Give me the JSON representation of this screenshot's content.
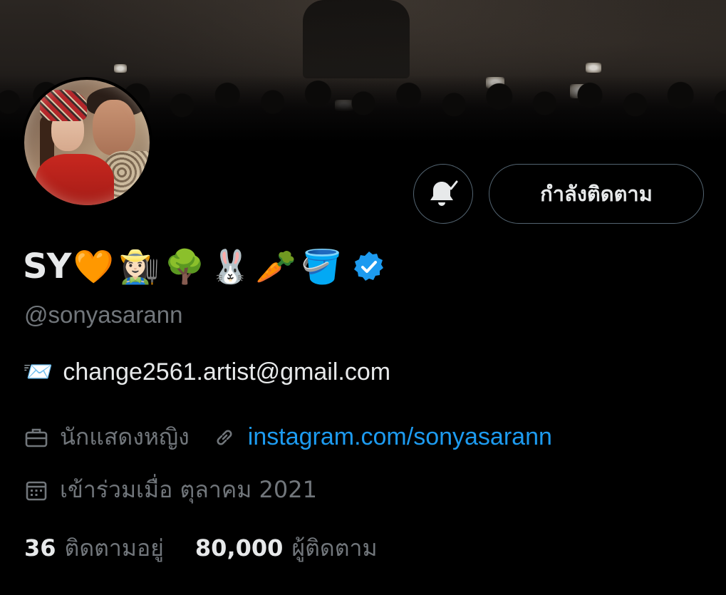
{
  "profile": {
    "display_name": "SY",
    "name_emojis": [
      "🧡",
      "👩🏻‍🌾",
      "🌳",
      "🐰",
      "🥕",
      "🪣"
    ],
    "verified": true,
    "handle": "@sonyasarann",
    "bio": {
      "email_emoji": "📨",
      "email": "change2561.artist@gmail.com"
    },
    "profession": "นักแสดงหญิง",
    "website": "instagram.com/sonyasarann",
    "joined": "เข้าร่วมเมื่อ ตุลาคม 2021",
    "following_count": "36",
    "following_label": "ติดตามอยู่",
    "followers_count": "80,000",
    "followers_label": "ผู้ติดตาม"
  },
  "actions": {
    "follow_label": "กำลังติดตาม",
    "notify_icon": "bell-check-icon"
  },
  "colors": {
    "background": "#000000",
    "primary_text": "#e7e9ea",
    "secondary_text": "#71767b",
    "link": "#1d9bf0",
    "verified": "#1d9bf0",
    "button_border": "#536471"
  }
}
